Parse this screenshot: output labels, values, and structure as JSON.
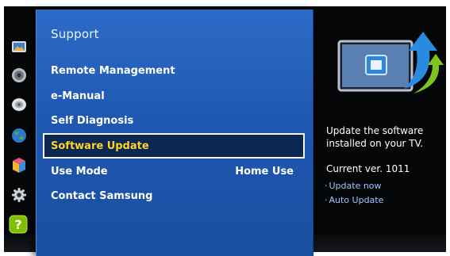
{
  "sidebar": {
    "icons": [
      {
        "name": "photo-icon"
      },
      {
        "name": "speaker-icon"
      },
      {
        "name": "satellite-dish-icon"
      },
      {
        "name": "globe-icon"
      },
      {
        "name": "apps-box-icon"
      },
      {
        "name": "gear-icon"
      },
      {
        "name": "question-icon",
        "label": "?"
      }
    ]
  },
  "panel": {
    "title": "Support",
    "items": [
      {
        "label": "Remote Management",
        "value": ""
      },
      {
        "label": "e-Manual",
        "value": ""
      },
      {
        "label": "Self Diagnosis",
        "value": ""
      },
      {
        "label": "Software Update",
        "value": "",
        "selected": true
      },
      {
        "label": "Use Mode",
        "value": "Home Use"
      },
      {
        "label": "Contact Samsung",
        "value": ""
      }
    ]
  },
  "info": {
    "description": "Update the software installed on your TV.",
    "current_version": "Current ver. 1011",
    "links": [
      {
        "label": "Update now"
      },
      {
        "label": "Auto Update"
      }
    ]
  },
  "colors": {
    "panel_blue": "#1f58b2",
    "selected_text": "#ffd42a",
    "link": "#9ec4ff",
    "help_green": "#7ec000"
  }
}
